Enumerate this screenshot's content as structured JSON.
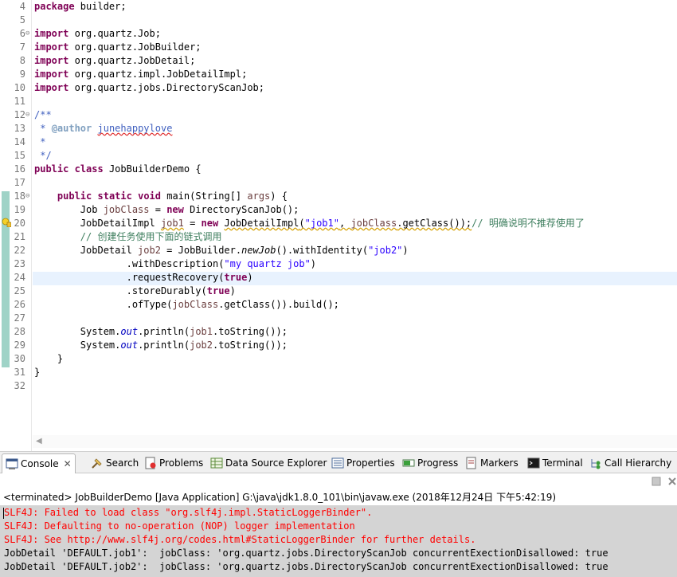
{
  "editor": {
    "line_numbers": [
      "4",
      "5",
      "6",
      "7",
      "8",
      "9",
      "10",
      "11",
      "12",
      "13",
      "14",
      "15",
      "16",
      "17",
      "18",
      "19",
      "20",
      "21",
      "22",
      "23",
      "24",
      "25",
      "26",
      "27",
      "28",
      "29",
      "30",
      "31",
      "32"
    ],
    "fold_markers": [
      "⊖",
      "⊖",
      "⊖"
    ],
    "lines": {
      "l4": {
        "k1": "package",
        "t1": " builder;"
      },
      "l6": {
        "k1": "import",
        "t1": " org.quartz.Job;"
      },
      "l7": {
        "k1": "import",
        "t1": " org.quartz.JobBuilder;"
      },
      "l8": {
        "k1": "import",
        "t1": " org.quartz.JobDetail;"
      },
      "l9": {
        "k1": "import",
        "t1": " org.quartz.impl.JobDetailImpl;"
      },
      "l10": {
        "k1": "import",
        "t1": " org.quartz.jobs.DirectoryScanJob;"
      },
      "l12": {
        "c1": "/**"
      },
      "l13": {
        "c1": " * ",
        "tag": "@author",
        "sp": " ",
        "name": "junehappylove"
      },
      "l14": {
        "c1": " *"
      },
      "l15": {
        "c1": " */"
      },
      "l16": {
        "k1": "public",
        "sp1": " ",
        "k2": "class",
        "t1": " JobBuilderDemo {"
      },
      "l18": {
        "ind": "    ",
        "k1": "public",
        "sp1": " ",
        "k2": "static",
        "sp2": " ",
        "k3": "void",
        "t1": " main(String[] ",
        "v1": "args",
        "t2": ") {"
      },
      "l19": {
        "ind": "        ",
        "t1": "Job ",
        "v1": "jobClass",
        "t2": " = ",
        "k1": "new",
        "t3": " DirectoryScanJob();"
      },
      "l20": {
        "ind": "        ",
        "t1": "JobDetailImpl ",
        "v1": "job1",
        "t2": " = ",
        "k1": "new",
        "sp": " ",
        "dep": "JobDetailImpl",
        "t3": "(",
        "s1": "\"job1\"",
        "t4": ", ",
        "v2": "jobClass",
        "t5": ".getClass());",
        "c1": "// 明确说明不推荐使用了"
      },
      "l21": {
        "ind": "        ",
        "c1": "// 创建任务使用下面的链式调用"
      },
      "l22": {
        "ind": "        ",
        "t1": "JobDetail ",
        "v1": "job2",
        "t2": " = JobBuilder.",
        "m1": "newJob",
        "t3": "().withIdentity(",
        "s1": "\"job2\"",
        "t4": ")"
      },
      "l23": {
        "ind": "                ",
        "t1": ".withDescription(",
        "s1": "\"my quartz job\"",
        "t2": ")"
      },
      "l24": {
        "ind": "                ",
        "t1": ".requestRecovery(",
        "k1": "true",
        "t2": ")"
      },
      "l25": {
        "ind": "                ",
        "t1": ".storeDurably(",
        "k1": "true",
        "t2": ")"
      },
      "l26": {
        "ind": "                ",
        "t1": ".ofType(",
        "v1": "jobClass",
        "t2": ".getClass()).build();"
      },
      "l28": {
        "ind": "        ",
        "t1": "System.",
        "f1": "out",
        "t2": ".println(",
        "v1": "job1",
        "t3": ".toString());"
      },
      "l29": {
        "ind": "        ",
        "t1": "System.",
        "f1": "out",
        "t2": ".println(",
        "v1": "job2",
        "t3": ".toString());"
      },
      "l30": {
        "ind": "    ",
        "t1": "}"
      },
      "l31": {
        "t1": "}"
      }
    }
  },
  "views": {
    "tabs": [
      {
        "label": "Console",
        "icon": "console-icon",
        "active": true
      },
      {
        "label": "Search",
        "icon": "search-icon"
      },
      {
        "label": "Problems",
        "icon": "problems-icon"
      },
      {
        "label": "Data Source Explorer",
        "icon": "data-source-icon"
      },
      {
        "label": "Properties",
        "icon": "properties-icon"
      },
      {
        "label": "Progress",
        "icon": "progress-icon"
      },
      {
        "label": "Markers",
        "icon": "markers-icon"
      },
      {
        "label": "Terminal",
        "icon": "terminal-icon"
      },
      {
        "label": "Call Hierarchy",
        "icon": "call-hierarchy-icon"
      }
    ],
    "close_glyph": "✕"
  },
  "console": {
    "header": "<terminated> JobBuilderDemo [Java Application] G:\\java\\jdk1.8.0_101\\bin\\javaw.exe (2018年12月24日 下午5:42:19)",
    "lines": [
      {
        "text": "SLF4J: Failed to load class \"org.slf4j.impl.StaticLoggerBinder\".",
        "kind": "err"
      },
      {
        "text": "SLF4J: Defaulting to no-operation (NOP) logger implementation",
        "kind": "err"
      },
      {
        "text": "SLF4J: See http://www.slf4j.org/codes.html#StaticLoggerBinder for further details.",
        "kind": "err"
      },
      {
        "text": "JobDetail 'DEFAULT.job1':  jobClass: 'org.quartz.jobs.DirectoryScanJob concurrentExectionDisallowed: true",
        "kind": "std"
      },
      {
        "text": "JobDetail 'DEFAULT.job2':  jobClass: 'org.quartz.jobs.DirectoryScanJob concurrentExectionDisallowed: true",
        "kind": "std"
      }
    ]
  },
  "colors": {
    "keyword": "#7f0055",
    "string": "#2a00ff",
    "comment": "#3f7f5f",
    "javadoc": "#3f5fbf",
    "error_output": "#ff0000",
    "console_bg": "#d4d4d4"
  }
}
